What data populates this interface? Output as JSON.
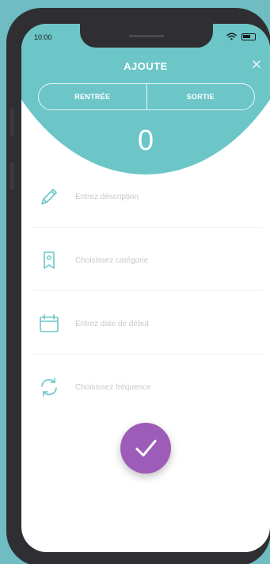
{
  "status": {
    "time": "10:00"
  },
  "header": {
    "title": "AJOUTE",
    "tabs": [
      {
        "label": "RENTRÉE"
      },
      {
        "label": "SORTIE"
      }
    ],
    "amount": "0"
  },
  "form": {
    "description_placeholder": "Entrez déscription",
    "category_placeholder": "Choisissez catégorie",
    "start_date_placeholder": "Entrez date de début",
    "frequency_placeholder": "Choisissez fréquence"
  },
  "colors": {
    "accent_teal": "#6cc6c8",
    "confirm_purple": "#9c5cb8"
  },
  "icons": {
    "description": "pencil-icon",
    "category": "tag-icon",
    "start_date": "calendar-icon",
    "frequency": "refresh-icon",
    "confirm": "check-icon",
    "close": "close-icon"
  }
}
